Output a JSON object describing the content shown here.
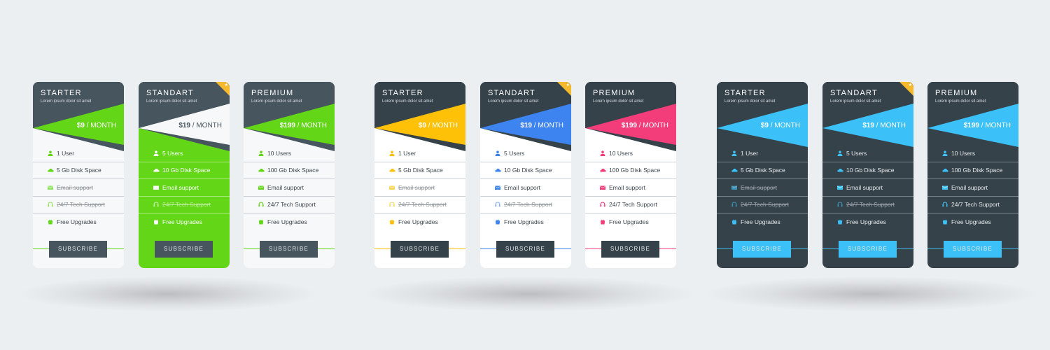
{
  "colors": {
    "background": "#eceff1",
    "header_dark": "#47555f",
    "header_darker": "#36424a",
    "green": "#62d617",
    "yellow": "#ffc107",
    "blue": "#3d84f0",
    "pink": "#f33d7a",
    "cyan": "#3bc1f7",
    "card_light": "#f7f8f9",
    "card_white": "#ffffff",
    "ribbon": "#f5b92e"
  },
  "groups": [
    {
      "name": "green-set",
      "cards": [
        {
          "title": "STARTER",
          "subtitle": "Lorem ipsum dolor sit amet",
          "price": "$9",
          "period": " / MONTH",
          "featured": false,
          "features": [
            {
              "icon": "user-icon",
              "label": "1 User",
              "included": true
            },
            {
              "icon": "cloud-icon",
              "label": "5 Gb Disk Space",
              "included": true
            },
            {
              "icon": "envelope-icon",
              "label": "Email support",
              "included": false
            },
            {
              "icon": "headset-icon",
              "label": "24/7 Tech Support",
              "included": false
            },
            {
              "icon": "gift-icon",
              "label": "Free Upgrades",
              "included": true
            }
          ],
          "button": "SUBSCRIBE"
        },
        {
          "title": "STANDART",
          "subtitle": "Lorem ipsum dolor sit amet",
          "price": "$19",
          "period": " / MONTH",
          "featured": true,
          "features": [
            {
              "icon": "user-icon",
              "label": "5 Users",
              "included": true
            },
            {
              "icon": "cloud-icon",
              "label": "10 Gb Disk Space",
              "included": true
            },
            {
              "icon": "envelope-icon",
              "label": "Email support",
              "included": true
            },
            {
              "icon": "headset-icon",
              "label": "24/7 Tech Support",
              "included": false
            },
            {
              "icon": "gift-icon",
              "label": "Free Upgrades",
              "included": true
            }
          ],
          "button": "SUBSCRIBE"
        },
        {
          "title": "PREMIUM",
          "subtitle": "Lorem ipsum dolor sit amet",
          "price": "$199",
          "period": " / MONTH",
          "featured": false,
          "features": [
            {
              "icon": "user-icon",
              "label": "10 Users",
              "included": true
            },
            {
              "icon": "cloud-icon",
              "label": "100 Gb Disk Space",
              "included": true
            },
            {
              "icon": "envelope-icon",
              "label": "Email support",
              "included": true
            },
            {
              "icon": "headset-icon",
              "label": "24/7 Tech Support",
              "included": true
            },
            {
              "icon": "gift-icon",
              "label": "Free Upgrades",
              "included": true
            }
          ],
          "button": "SUBSCRIBE"
        }
      ]
    },
    {
      "name": "multicolor-set",
      "cards": [
        {
          "title": "STARTER",
          "subtitle": "Lorem ipsum dolor sit amet",
          "price": "$9",
          "period": " / MONTH",
          "featured": false,
          "features": [
            {
              "icon": "user-icon",
              "label": "1 User",
              "included": true
            },
            {
              "icon": "cloud-icon",
              "label": "5 Gb Disk Space",
              "included": true
            },
            {
              "icon": "envelope-icon",
              "label": "Email support",
              "included": false
            },
            {
              "icon": "headset-icon",
              "label": "24/7 Tech Support",
              "included": false
            },
            {
              "icon": "gift-icon",
              "label": "Free Upgrades",
              "included": true
            }
          ],
          "button": "SUBSCRIBE"
        },
        {
          "title": "STANDART",
          "subtitle": "Lorem ipsum dolor sit amet",
          "price": "$19",
          "period": " / MONTH",
          "featured": true,
          "features": [
            {
              "icon": "user-icon",
              "label": "5 Users",
              "included": true
            },
            {
              "icon": "cloud-icon",
              "label": "10 Gb Disk Space",
              "included": true
            },
            {
              "icon": "envelope-icon",
              "label": "Email support",
              "included": true
            },
            {
              "icon": "headset-icon",
              "label": "24/7 Tech Support",
              "included": false
            },
            {
              "icon": "gift-icon",
              "label": "Free Upgrades",
              "included": true
            }
          ],
          "button": "SUBSCRIBE"
        },
        {
          "title": "PREMIUM",
          "subtitle": "Lorem ipsum dolor sit amet",
          "price": "$199",
          "period": " / MONTH",
          "featured": false,
          "features": [
            {
              "icon": "user-icon",
              "label": "10 Users",
              "included": true
            },
            {
              "icon": "cloud-icon",
              "label": "100 Gb Disk Space",
              "included": true
            },
            {
              "icon": "envelope-icon",
              "label": "Email support",
              "included": true
            },
            {
              "icon": "headset-icon",
              "label": "24/7 Tech Support",
              "included": true
            },
            {
              "icon": "gift-icon",
              "label": "Free Upgrades",
              "included": true
            }
          ],
          "button": "SUBSCRIBE"
        }
      ]
    },
    {
      "name": "dark-set",
      "cards": [
        {
          "title": "STARTER",
          "subtitle": "Lorem ipsum dolor sit amet",
          "price": "$9",
          "period": " / MONTH",
          "featured": false,
          "features": [
            {
              "icon": "user-icon",
              "label": "1 User",
              "included": true
            },
            {
              "icon": "cloud-icon",
              "label": "5 Gb Disk Space",
              "included": true
            },
            {
              "icon": "envelope-icon",
              "label": "Email support",
              "included": false
            },
            {
              "icon": "headset-icon",
              "label": "24/7 Tech Support",
              "included": false
            },
            {
              "icon": "gift-icon",
              "label": "Free Upgrades",
              "included": true
            }
          ],
          "button": "SUBSCRIBE"
        },
        {
          "title": "STANDART",
          "subtitle": "Lorem ipsum dolor sit amet",
          "price": "$19",
          "period": " / MONTH",
          "featured": true,
          "features": [
            {
              "icon": "user-icon",
              "label": "5 Users",
              "included": true
            },
            {
              "icon": "cloud-icon",
              "label": "10 Gb Disk Space",
              "included": true
            },
            {
              "icon": "envelope-icon",
              "label": "Email support",
              "included": true
            },
            {
              "icon": "headset-icon",
              "label": "24/7 Tech Support",
              "included": false
            },
            {
              "icon": "gift-icon",
              "label": "Free Upgrades",
              "included": true
            }
          ],
          "button": "SUBSCRIBE"
        },
        {
          "title": "PREMIUM",
          "subtitle": "Lorem ipsum dolor sit amet",
          "price": "$199",
          "period": " / MONTH",
          "featured": false,
          "features": [
            {
              "icon": "user-icon",
              "label": "10 Users",
              "included": true
            },
            {
              "icon": "cloud-icon",
              "label": "100 Gb Disk Space",
              "included": true
            },
            {
              "icon": "envelope-icon",
              "label": "Email support",
              "included": true
            },
            {
              "icon": "headset-icon",
              "label": "24/7 Tech Support",
              "included": true
            },
            {
              "icon": "gift-icon",
              "label": "Free Upgrades",
              "included": true
            }
          ],
          "button": "SUBSCRIBE"
        }
      ]
    }
  ]
}
